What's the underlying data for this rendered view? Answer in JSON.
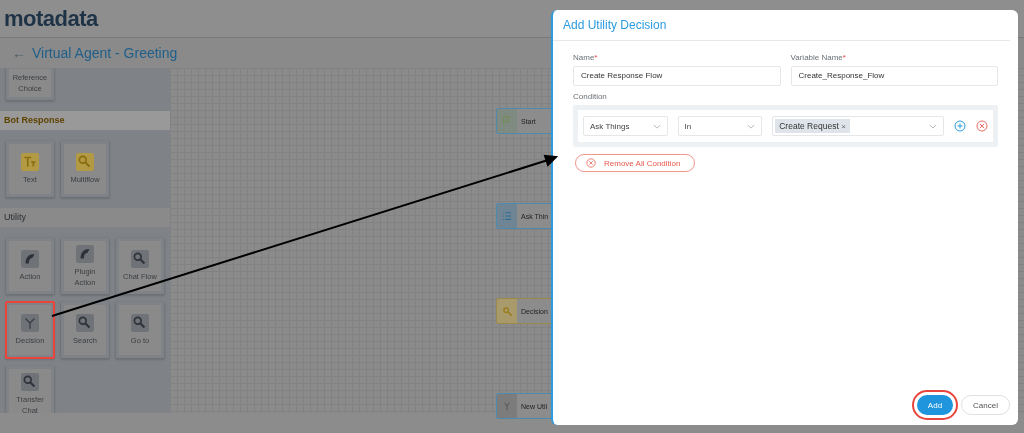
{
  "header": {
    "logo": "motadata"
  },
  "page": {
    "back": "←",
    "title": "Virtual Agent - Greeting"
  },
  "palette": [
    {
      "items": [
        {
          "label": "Reference Choice",
          "kind": "plain",
          "highlighted": false
        }
      ]
    },
    {
      "title": "Bot Response",
      "accent": true,
      "items": [
        {
          "label": "Text",
          "kind": "text",
          "highlighted": false
        },
        {
          "label": "Multiflow",
          "kind": "key",
          "highlighted": false
        }
      ]
    },
    {
      "title": "Utility",
      "accent": false,
      "items": [
        {
          "label": "Action",
          "kind": "action",
          "highlighted": false
        },
        {
          "label": "Plugin Action",
          "kind": "action",
          "highlighted": false
        },
        {
          "label": "Chat Flow",
          "kind": "key",
          "highlighted": false
        },
        {
          "label": "Decision",
          "kind": "split",
          "highlighted": true
        },
        {
          "label": "Search",
          "kind": "key",
          "highlighted": false
        },
        {
          "label": "Go to",
          "kind": "key",
          "highlighted": false
        },
        {
          "label": "Transfer Chat",
          "kind": "key",
          "highlighted": false
        }
      ]
    }
  ],
  "canvas_nodes": [
    {
      "label": "Start",
      "kind": "start"
    },
    {
      "label": "Ask Thin",
      "kind": "list"
    },
    {
      "label": "Decision",
      "kind": "decision"
    },
    {
      "label": "New Util",
      "kind": "utility"
    }
  ],
  "dialog": {
    "title": "Add Utility Decision",
    "fields": [
      {
        "label": "Name",
        "required_mark": "*",
        "value": "Create Response Flow"
      },
      {
        "label": "Variable Name",
        "required_mark": "*",
        "value": "Create_Response_Flow"
      }
    ],
    "condition_label": "Condition",
    "conditions": [
      {
        "field": "Ask Things",
        "operator": "In",
        "tags": [
          "Create Request"
        ],
        "tag_remove": "×"
      }
    ],
    "remove_all": "Remove All Condition",
    "buttons": [
      {
        "label": "Add",
        "kind": "primary",
        "highlighted": true
      },
      {
        "label": "Cancel",
        "kind": "secondary",
        "highlighted": false
      }
    ]
  }
}
